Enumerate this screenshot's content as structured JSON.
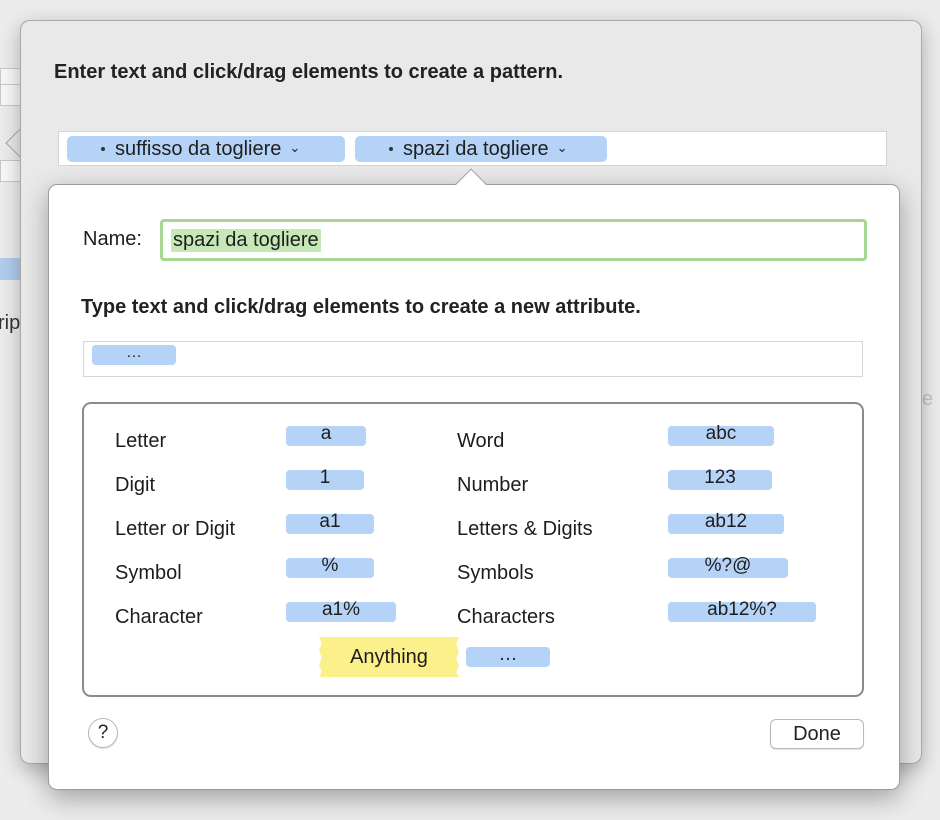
{
  "background": {
    "fragment_rip": "rip"
  },
  "pattern_editor": {
    "title": "Enter text and click/drag elements to create a pattern.",
    "tokens": [
      {
        "label": "suffisso da togliere",
        "chevron": "chevron-down-icon"
      },
      {
        "label": "spazi da togliere",
        "chevron": "chevron-down-icon"
      }
    ]
  },
  "attribute_editor": {
    "name_label": "Name:",
    "name_value": "spazi da togliere",
    "instruction": "Type text and click/drag elements to create a new attribute.",
    "attribute_token": "…",
    "palette": {
      "left": [
        {
          "label": "Letter",
          "chip": "a"
        },
        {
          "label": "Digit",
          "chip": "1"
        },
        {
          "label": "Letter or Digit",
          "chip": "a1"
        },
        {
          "label": "Symbol",
          "chip": "%"
        },
        {
          "label": "Character",
          "chip": "a1%"
        }
      ],
      "right": [
        {
          "label": "Word",
          "chip": "abc"
        },
        {
          "label": "Number",
          "chip": "123"
        },
        {
          "label": "Letters & Digits",
          "chip": "ab12"
        },
        {
          "label": "Symbols",
          "chip": "%?@"
        },
        {
          "label": "Characters",
          "chip": "ab12%?"
        }
      ],
      "anything_label": "Anything",
      "ellipsis_chip": "…"
    },
    "help_label": "?",
    "done_label": "Done"
  },
  "colors": {
    "token_blue": "#b5d3f6",
    "anything_yellow": "#fcf08a",
    "focus_green": "#a7d592"
  }
}
